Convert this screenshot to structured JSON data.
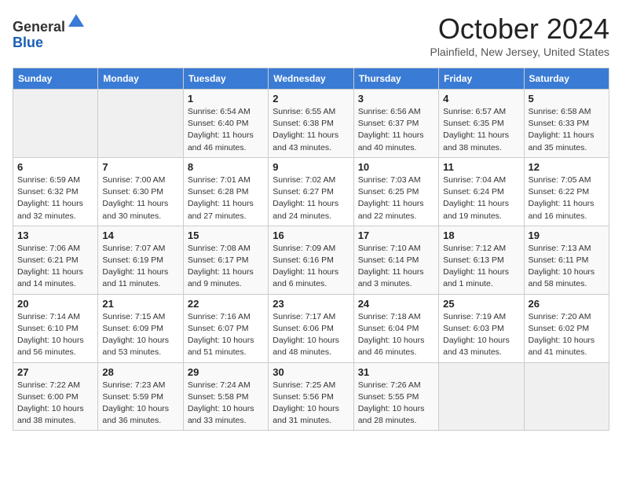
{
  "header": {
    "logo_line1": "General",
    "logo_line2": "Blue",
    "month_title": "October 2024",
    "location": "Plainfield, New Jersey, United States"
  },
  "days_of_week": [
    "Sunday",
    "Monday",
    "Tuesday",
    "Wednesday",
    "Thursday",
    "Friday",
    "Saturday"
  ],
  "weeks": [
    [
      {
        "day": "",
        "info": ""
      },
      {
        "day": "",
        "info": ""
      },
      {
        "day": "1",
        "info": "Sunrise: 6:54 AM\nSunset: 6:40 PM\nDaylight: 11 hours and 46 minutes."
      },
      {
        "day": "2",
        "info": "Sunrise: 6:55 AM\nSunset: 6:38 PM\nDaylight: 11 hours and 43 minutes."
      },
      {
        "day": "3",
        "info": "Sunrise: 6:56 AM\nSunset: 6:37 PM\nDaylight: 11 hours and 40 minutes."
      },
      {
        "day": "4",
        "info": "Sunrise: 6:57 AM\nSunset: 6:35 PM\nDaylight: 11 hours and 38 minutes."
      },
      {
        "day": "5",
        "info": "Sunrise: 6:58 AM\nSunset: 6:33 PM\nDaylight: 11 hours and 35 minutes."
      }
    ],
    [
      {
        "day": "6",
        "info": "Sunrise: 6:59 AM\nSunset: 6:32 PM\nDaylight: 11 hours and 32 minutes."
      },
      {
        "day": "7",
        "info": "Sunrise: 7:00 AM\nSunset: 6:30 PM\nDaylight: 11 hours and 30 minutes."
      },
      {
        "day": "8",
        "info": "Sunrise: 7:01 AM\nSunset: 6:28 PM\nDaylight: 11 hours and 27 minutes."
      },
      {
        "day": "9",
        "info": "Sunrise: 7:02 AM\nSunset: 6:27 PM\nDaylight: 11 hours and 24 minutes."
      },
      {
        "day": "10",
        "info": "Sunrise: 7:03 AM\nSunset: 6:25 PM\nDaylight: 11 hours and 22 minutes."
      },
      {
        "day": "11",
        "info": "Sunrise: 7:04 AM\nSunset: 6:24 PM\nDaylight: 11 hours and 19 minutes."
      },
      {
        "day": "12",
        "info": "Sunrise: 7:05 AM\nSunset: 6:22 PM\nDaylight: 11 hours and 16 minutes."
      }
    ],
    [
      {
        "day": "13",
        "info": "Sunrise: 7:06 AM\nSunset: 6:21 PM\nDaylight: 11 hours and 14 minutes."
      },
      {
        "day": "14",
        "info": "Sunrise: 7:07 AM\nSunset: 6:19 PM\nDaylight: 11 hours and 11 minutes."
      },
      {
        "day": "15",
        "info": "Sunrise: 7:08 AM\nSunset: 6:17 PM\nDaylight: 11 hours and 9 minutes."
      },
      {
        "day": "16",
        "info": "Sunrise: 7:09 AM\nSunset: 6:16 PM\nDaylight: 11 hours and 6 minutes."
      },
      {
        "day": "17",
        "info": "Sunrise: 7:10 AM\nSunset: 6:14 PM\nDaylight: 11 hours and 3 minutes."
      },
      {
        "day": "18",
        "info": "Sunrise: 7:12 AM\nSunset: 6:13 PM\nDaylight: 11 hours and 1 minute."
      },
      {
        "day": "19",
        "info": "Sunrise: 7:13 AM\nSunset: 6:11 PM\nDaylight: 10 hours and 58 minutes."
      }
    ],
    [
      {
        "day": "20",
        "info": "Sunrise: 7:14 AM\nSunset: 6:10 PM\nDaylight: 10 hours and 56 minutes."
      },
      {
        "day": "21",
        "info": "Sunrise: 7:15 AM\nSunset: 6:09 PM\nDaylight: 10 hours and 53 minutes."
      },
      {
        "day": "22",
        "info": "Sunrise: 7:16 AM\nSunset: 6:07 PM\nDaylight: 10 hours and 51 minutes."
      },
      {
        "day": "23",
        "info": "Sunrise: 7:17 AM\nSunset: 6:06 PM\nDaylight: 10 hours and 48 minutes."
      },
      {
        "day": "24",
        "info": "Sunrise: 7:18 AM\nSunset: 6:04 PM\nDaylight: 10 hours and 46 minutes."
      },
      {
        "day": "25",
        "info": "Sunrise: 7:19 AM\nSunset: 6:03 PM\nDaylight: 10 hours and 43 minutes."
      },
      {
        "day": "26",
        "info": "Sunrise: 7:20 AM\nSunset: 6:02 PM\nDaylight: 10 hours and 41 minutes."
      }
    ],
    [
      {
        "day": "27",
        "info": "Sunrise: 7:22 AM\nSunset: 6:00 PM\nDaylight: 10 hours and 38 minutes."
      },
      {
        "day": "28",
        "info": "Sunrise: 7:23 AM\nSunset: 5:59 PM\nDaylight: 10 hours and 36 minutes."
      },
      {
        "day": "29",
        "info": "Sunrise: 7:24 AM\nSunset: 5:58 PM\nDaylight: 10 hours and 33 minutes."
      },
      {
        "day": "30",
        "info": "Sunrise: 7:25 AM\nSunset: 5:56 PM\nDaylight: 10 hours and 31 minutes."
      },
      {
        "day": "31",
        "info": "Sunrise: 7:26 AM\nSunset: 5:55 PM\nDaylight: 10 hours and 28 minutes."
      },
      {
        "day": "",
        "info": ""
      },
      {
        "day": "",
        "info": ""
      }
    ]
  ]
}
